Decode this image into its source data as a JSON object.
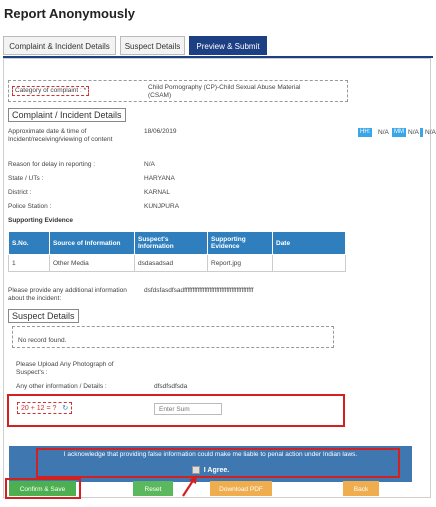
{
  "page_title": "Report Anonymously",
  "tabs": [
    {
      "label": "Complaint & Incident Details"
    },
    {
      "label": "Suspect Details"
    },
    {
      "label": "Preview & Submit"
    }
  ],
  "category": {
    "label": "Category of complaint : *",
    "value": "Child Pornography (CP)-Child Sexual Abuse Material (CSAM)"
  },
  "incident_section": {
    "heading": "Complaint / Incident Details",
    "date_label": "Approximate date & time of Incident/receiving/viewing of content",
    "date_value": "18/06/2019",
    "hh_label": "HH:",
    "hh_value": "N/A",
    "mm_label": "MM",
    "mm_value": "N/A",
    "ampm_value": "N/A",
    "delay_label": "Reason for delay in reporting :",
    "delay_value": "N/A",
    "state_label": "State / UTs :",
    "state_value": "HARYANA",
    "district_label": "District :",
    "district_value": "KARNAL",
    "police_label": "Police Station :",
    "police_value": "KUNJPURA",
    "evidence_heading": "Supporting Evidence"
  },
  "evidence_table": {
    "headers": [
      "S.No.",
      "Source of Information",
      "Suspect's Information",
      "Supporting Evidence",
      "Date"
    ],
    "rows": [
      [
        "1",
        "Other Media",
        "dsdasadsad",
        "Report.jpg",
        ""
      ]
    ]
  },
  "additional_info": {
    "label": "Please provide any additional information about the incident:",
    "value": "dsfdsfasdfsadfffffffffffffffffffffffffffffffffffffffff"
  },
  "suspect_section": {
    "heading": "Suspect Details",
    "no_record": "No record found.",
    "photo_label": "Please Upload Any Photograph of Suspect's :",
    "other_label": "Any other information / Details :",
    "other_value": "dfsdfsdfsda"
  },
  "captcha": {
    "question": "20 + 12 = ?",
    "placeholder": "Enter Sum"
  },
  "acknowledgement": {
    "text": "I acknowledge that providing false information could make me liable to penal action under Indian laws.",
    "agree_label": "I Agree."
  },
  "buttons": {
    "confirm": "Confirm & Save",
    "reset": "Reset",
    "download": "Download PDF",
    "back": "Back"
  },
  "colors": {
    "tab_active": "#1d3f84",
    "table_header": "#2f7fbf",
    "highlight": "#d32020",
    "confirm": "#4caf50",
    "reset": "#5cb85c",
    "download": "#f0ad4e",
    "back": "#f0ad4e",
    "ack_bg": "#3f78b0"
  }
}
